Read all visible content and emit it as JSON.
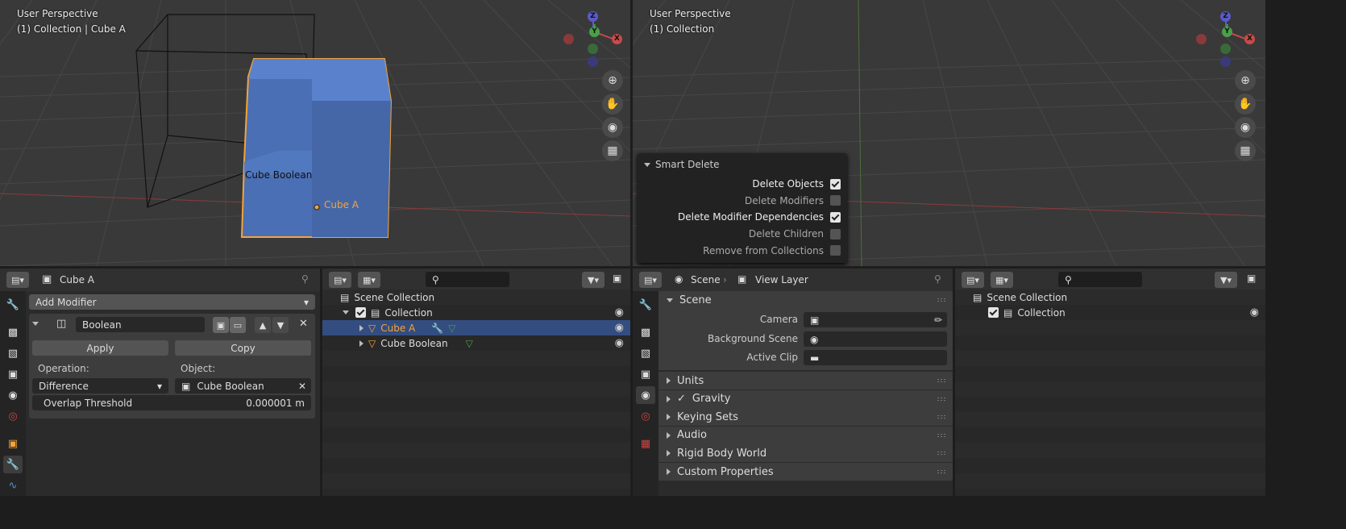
{
  "viewport_left": {
    "perspective": "User Perspective",
    "collection": "(1) Collection | Cube A",
    "labels": {
      "cube_boolean": "Cube Boolean",
      "cube_a": "Cube A"
    },
    "gizmo": {
      "z": "Z",
      "y": "Y",
      "x": "X"
    }
  },
  "viewport_right": {
    "perspective": "User Perspective",
    "collection": "(1) Collection",
    "gizmo": {
      "z": "Z",
      "y": "Y",
      "x": "X"
    },
    "smart_delete": {
      "title": "Smart Delete",
      "options": [
        {
          "label": "Delete Objects",
          "checked": true
        },
        {
          "label": "Delete Modifiers",
          "checked": false
        },
        {
          "label": "Delete Modifier Dependencies",
          "checked": true
        },
        {
          "label": "Delete Children",
          "checked": false
        },
        {
          "label": "Remove from Collections",
          "checked": false
        }
      ]
    }
  },
  "modifier_panel": {
    "object_name": "Cube A",
    "add_modifier": "Add Modifier",
    "modifier_name": "Boolean",
    "apply": "Apply",
    "copy": "Copy",
    "operation_label": "Operation:",
    "operation_value": "Difference",
    "object_label": "Object:",
    "object_value": "Cube Boolean",
    "overlap_label": "Overlap Threshold",
    "overlap_value": "0.000001 m"
  },
  "outliner_left": {
    "scene_collection": "Scene Collection",
    "collection": "Collection",
    "items": [
      "Cube A",
      "Cube Boolean"
    ]
  },
  "scene_panel": {
    "breadcrumb_scene": "Scene",
    "breadcrumb_view_layer": "View Layer",
    "section_scene": "Scene",
    "camera_label": "Camera",
    "background_label": "Background Scene",
    "clip_label": "Active Clip",
    "sections": [
      "Units",
      "Gravity",
      "Keying Sets",
      "Audio",
      "Rigid Body World",
      "Custom Properties"
    ]
  },
  "outliner_right": {
    "scene_collection": "Scene Collection",
    "collection": "Collection"
  },
  "colors": {
    "accent": "#4772b3",
    "selected_orange": "#f5a33a",
    "panel_bg": "#2b2b2b",
    "viewport_bg": "#393939"
  }
}
